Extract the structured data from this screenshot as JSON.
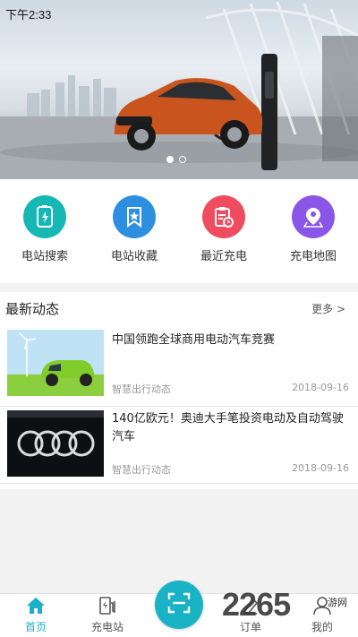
{
  "status_bar": {
    "time": "下午2:33"
  },
  "banner": {
    "slide_count": 2,
    "active_slide": 0
  },
  "quick_actions": [
    {
      "label": "电站搜索",
      "icon": "station-search-icon",
      "color": "#16b8b3"
    },
    {
      "label": "电站收藏",
      "icon": "bookmark-icon",
      "color": "#2c8fe0"
    },
    {
      "label": "最近充电",
      "icon": "recent-charge-icon",
      "color": "#ef4d5f"
    },
    {
      "label": "充电地图",
      "icon": "map-pin-icon",
      "color": "#8a56e8"
    }
  ],
  "news": {
    "title": "最新动态",
    "more_label": "更多 >",
    "items": [
      {
        "headline": "中国领跑全球商用电动汽车竞赛",
        "source": "智慧出行动态",
        "date": "2018-09-16"
      },
      {
        "headline": "140亿欧元！奥迪大手笔投资电动及自动驾驶汽车",
        "source": "智慧出行动态",
        "date": "2018-09-16"
      }
    ]
  },
  "bottom_nav": {
    "tabs": [
      {
        "label": "首页",
        "icon": "home-icon",
        "active": true
      },
      {
        "label": "充电站",
        "icon": "charger-icon",
        "active": false
      },
      {
        "label": "订单",
        "icon": "order-icon",
        "active": false
      },
      {
        "label": "我的",
        "icon": "profile-icon",
        "active": false
      }
    ],
    "scan_icon": "scan-icon",
    "accent_color": "#19b1c9"
  },
  "watermark": {
    "text": "2265",
    "sub": "游网"
  }
}
